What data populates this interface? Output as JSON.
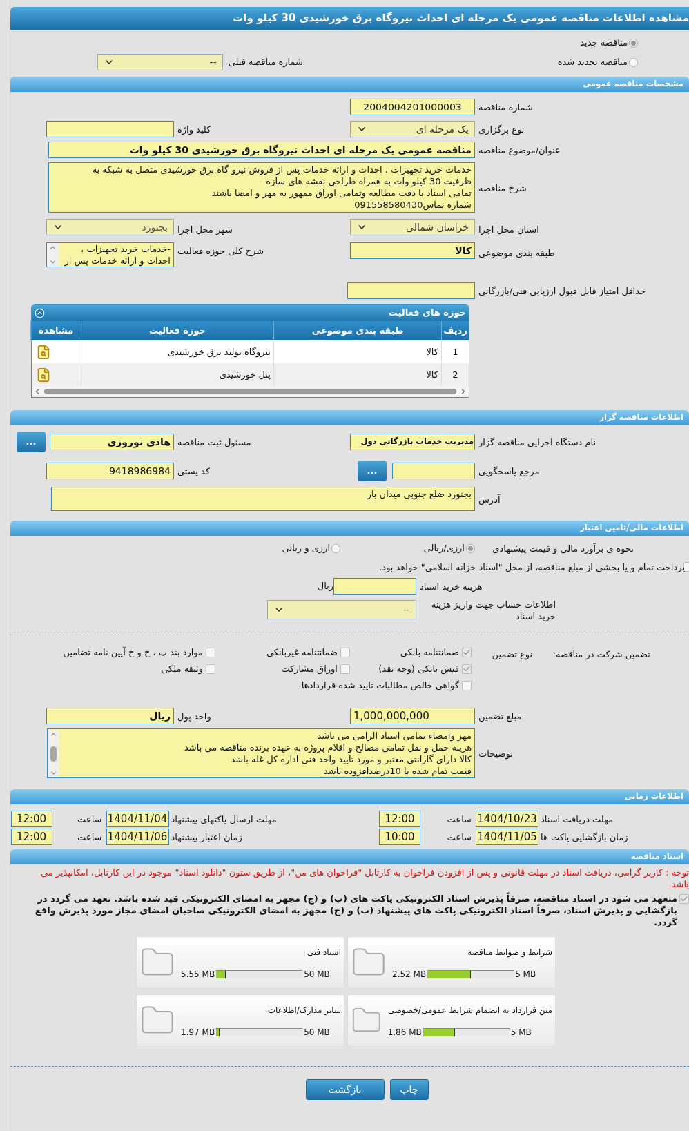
{
  "page_title": "مشاهده اطلاعات مناقصه عمومی یک مرحله ای احداث نیروگاه برق خورشیدی 30 کیلو وات",
  "tender_kind": [
    {
      "label": "مناقصه جدید",
      "selected": true
    },
    {
      "label": "مناقصه تجدید شده",
      "selected": false
    }
  ],
  "previous_tender": {
    "label": "شماره مناقصه قبلی",
    "value": "--"
  },
  "general": {
    "title": "مشخصات مناقصه عمومی",
    "number": {
      "label": "شماره مناقصه",
      "value": "2004004201000003"
    },
    "holding_type": {
      "label": "نوع برگزاری",
      "value": "یک مرحله ای"
    },
    "keyword": {
      "label": "کلید واژه"
    },
    "subject": {
      "label": "عنوان/موضوع مناقصه",
      "value": "مناقصه عمومی یک مرحله ای احداث نیروگاه برق خورشیدی 30 کیلو وات"
    },
    "description": {
      "label": "شرح مناقصه",
      "lines": [
        "خدمات خرید تجهیزات ، احداث و ارائه خدمات پس از فروش نیرو گاه برق خورشیدی متصل به شبکه به",
        "ظرفیت 30 کیلو وات به همراه طراحی نقشه های سازه-",
        "تمامی اسناد با دقت مطالعه وتمامی اوراق ممهور به مهر و امضا باشند",
        "شماره تماس091558580430"
      ]
    },
    "province": {
      "label": "استان محل اجرا",
      "value": "خراسان شمالی"
    },
    "city": {
      "label": "شهر محل اجرا",
      "value": "بجنورد"
    },
    "category": {
      "label": "طبقه بندی موضوعی",
      "value": "کالا"
    },
    "activity_summary": {
      "label": "شرح کلی حوزه فعالیت",
      "lines": [
        "-خدمات خرید تجهیزات ،",
        "احداث و ارائه خدمات پس از"
      ]
    },
    "min_score": {
      "label": "حداقل امتیاز قابل قبول ارزیابی فنی/بازرگانی"
    }
  },
  "activities": {
    "title": "حوزه های فعالیت",
    "columns": [
      "ردیف",
      "طبقه بندی موضوعی",
      "حوزه فعالیت",
      "مشاهده"
    ],
    "rows": [
      {
        "index": "1",
        "category": "کالا",
        "field": "نیروگاه تولید برق خورشیدی"
      },
      {
        "index": "2",
        "category": "کالا",
        "field": "پنل خورشیدی"
      }
    ]
  },
  "organizer": {
    "title": "اطلاعات مناقصه گزار",
    "agency": {
      "label": "نام دستگاه اجرایی مناقصه گزار",
      "value": "مدیریت خدمات بازرگانی دول"
    },
    "registrar": {
      "label": "مسئول ثبت مناقصه",
      "value": "هادی نوروزی",
      "button": "..."
    },
    "reference": {
      "label": "مرجع پاسخگویی",
      "button": "..."
    },
    "postal_code": {
      "label": "کد پستی",
      "value": "9418986984"
    },
    "address": {
      "label": "آدرس",
      "value": "بجنورد ضلع جنوبی میدان بار"
    }
  },
  "finance": {
    "title": "اطلاعات مالی/تامین اعتبار",
    "estimate_label": "نحوه ی برآورد مالی و قیمت پیشنهادی",
    "estimate_options": [
      {
        "label": "ارزی/ریالی",
        "selected": true
      },
      {
        "label": "ارزی و ریالی",
        "selected": false
      }
    ],
    "treasury": {
      "label": "پرداخت تمام و یا بخشی از مبلغ مناقصه، از محل \"اسناد خزانه اسلامی\" خواهد بود.",
      "checked": false
    },
    "doc_fee": {
      "label": "هزینه خرید اسناد",
      "unit": "ریال"
    },
    "account": {
      "label": "اطلاعات حساب جهت واریز هزینه خرید اسناد",
      "value": "--"
    }
  },
  "guarantee": {
    "label": "تضمین شرکت در مناقصه:",
    "type_label": "نوع تضمین",
    "options": [
      {
        "label": "ضمانتنامه بانکی",
        "checked": true
      },
      {
        "label": "ضمانتنامه غیربانکی",
        "checked": false
      },
      {
        "label": "موارد بند پ ، ح و خ آیین نامه تضامین",
        "checked": false
      },
      {
        "label": "فیش بانکی (وجه نقد)",
        "checked": true
      },
      {
        "label": "اوراق مشارکت",
        "checked": false
      },
      {
        "label": "وثیقه ملکی",
        "checked": false
      },
      {
        "label": "گواهی خالص مطالبات تایید شده قراردادها",
        "checked": false
      }
    ],
    "amount": {
      "label": "مبلغ تضمین",
      "value": "1,000,000,000"
    },
    "currency": {
      "label": "واحد پول",
      "value": "ریال"
    },
    "notes": {
      "label": "توضیحات",
      "lines": [
        "مهر وامضاء تمامی اسناد الزامی می باشد",
        "هزینه حمل و نقل تمامی مصالح و اقلام پروژه به عهده برنده مناقصه می باشد",
        "کالا دارای گارانتی معتبر  و مورد تایید واحد فنی اداره کل غله باشد",
        "قیمت تمام شده با 10درصدافزوده باشد"
      ]
    }
  },
  "timing": {
    "title": "اطلاعات زمانی",
    "items": [
      {
        "label": "مهلت دریافت اسناد",
        "date": "1404/10/23",
        "time_label": "ساعت",
        "time": "12:00"
      },
      {
        "label": "مهلت ارسال پاکتهای پیشنهاد",
        "date": "1404/11/04",
        "time_label": "ساعت",
        "time": "12:00"
      },
      {
        "label": "زمان بازگشایی پاکت ها",
        "date": "1404/11/05",
        "time_label": "ساعت",
        "time": "10:00"
      },
      {
        "label": "زمان اعتبار پیشنهاد",
        "date": "1404/11/06",
        "time_label": "ساعت",
        "time": "12:00"
      }
    ]
  },
  "documents": {
    "title": "اسناد مناقصه",
    "notice": "توجه : کاربر گرامی، دریافت اسناد در مهلت قانونی و پس از افزودن فراخوان به کارتابل \"فراخوان های من\"، از طریق ستون \"دانلود اسناد\" موجود در این کارتابل، امکانپذیر می باشد.",
    "commitment": {
      "text": "متعهد می شود در اسناد مناقصه، صرفاً پذیرش اسناد الکترونیکی پاکت های (ب) و (ج) مجهز به امضای الکترونیکی قید شده باشد. تعهد می گردد در بازگشایی و پذیرش اسناد، صرفاً اسناد الکترونیکی پاکت های پیشنهاد (ب) و (ج) مجهز به امضای الکترونیکی صاحبان امضای مجاز مورد پذیرش واقع گردد.",
      "checked": true
    },
    "files": [
      {
        "name": "شرایط و ضوابط مناقصه",
        "size": "2.52 MB",
        "max": "5 MB",
        "level": 0.504
      },
      {
        "name": "اسناد فنی",
        "size": "5.55 MB",
        "max": "50 MB",
        "level": 0.111
      },
      {
        "name": "متن قرارداد به انضمام شرایط عمومی/خصوصی",
        "size": "1.86 MB",
        "max": "5 MB",
        "level": 0.372
      },
      {
        "name": "سایر مدارک/اطلاعات",
        "size": "1.97 MB",
        "max": "50 MB",
        "level": 0.039
      }
    ]
  },
  "buttons": [
    {
      "label": "چاپ"
    },
    {
      "label": "بازگشت"
    }
  ]
}
